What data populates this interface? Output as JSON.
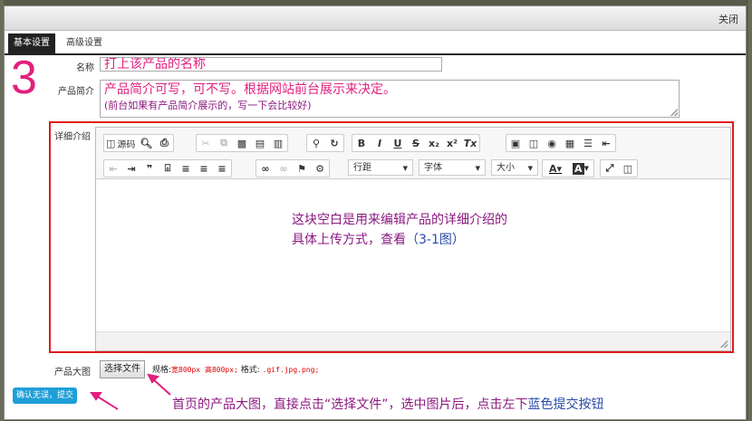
{
  "window": {
    "close_label": "关闭"
  },
  "tabs": [
    {
      "label": "基本设置",
      "active": true
    },
    {
      "label": "高级设置",
      "active": false
    }
  ],
  "step_number": "3",
  "form": {
    "name": {
      "label": "名称",
      "value": "打上该产品的名称"
    },
    "summary": {
      "label": "产品简介",
      "line1": "产品简介可写，可不写。根据网站前台展示来决定。",
      "line2": "(前台如果有产品简介展示的，写一下会比较好)"
    },
    "detail": {
      "label": "详细介绍"
    },
    "image": {
      "label": "产品大图",
      "button_label": "选择文件",
      "spec_prefix": "规格:",
      "spec_size": "宽800px 高800px;",
      "format_prefix": "格式:",
      "format_value": ".gif.jpg.png;"
    }
  },
  "editor": {
    "toolbar_row1": [
      {
        "icon": "source-icon",
        "text": "源码"
      },
      {
        "icon": "preview-icon"
      },
      {
        "icon": "print-icon"
      },
      {
        "icon": "cut-icon"
      },
      {
        "icon": "copy-icon"
      },
      {
        "icon": "paste-icon"
      },
      {
        "icon": "paste-text-icon"
      },
      {
        "icon": "paste-word-icon"
      },
      {
        "icon": "find-icon"
      },
      {
        "icon": "replace-icon"
      },
      {
        "icon": "bold-icon",
        "glyph": "B"
      },
      {
        "icon": "italic-icon",
        "glyph": "I"
      },
      {
        "icon": "underline-icon",
        "glyph": "U"
      },
      {
        "icon": "strike-icon",
        "glyph": "S"
      },
      {
        "icon": "subscript-icon",
        "glyph": "x₂"
      },
      {
        "icon": "superscript-icon",
        "glyph": "x²"
      },
      {
        "icon": "clear-format-icon",
        "glyph": "Tx"
      },
      {
        "icon": "image-icon"
      },
      {
        "icon": "multi-image-icon"
      },
      {
        "icon": "flash-icon"
      },
      {
        "icon": "table-icon"
      },
      {
        "icon": "hr-icon"
      },
      {
        "icon": "pagebreak-icon"
      }
    ],
    "selects": {
      "line_height": "行距",
      "font": "字体",
      "size": "大小"
    },
    "content_note": {
      "line1": "这块空白是用来编辑产品的详细介绍的",
      "line2_prefix": "具体上传方式，查看",
      "line2_link": "（3-1图）"
    }
  },
  "submit": {
    "label": "确认无误，提交"
  },
  "bottom_note": {
    "text": "首页的产品大图，直接点击“选择文件”，选中图片后，点击左下",
    "highlight": "蓝色提交按钮"
  },
  "colors": {
    "annotation_pink": "#e0207e",
    "annotation_purple": "#8b1a80",
    "highlight_red": "#e01b1b",
    "submit_blue": "#1e9fd8"
  }
}
